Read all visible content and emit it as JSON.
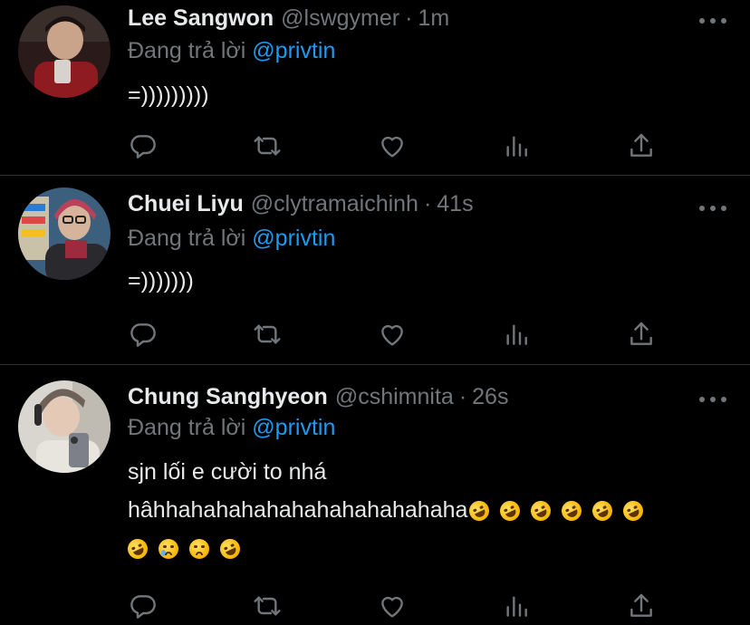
{
  "colors": {
    "background": "#000000",
    "text_primary": "#e7e9ea",
    "text_secondary": "#71767b",
    "mention": "#1d9bf0",
    "divider": "#2f3336"
  },
  "reply_prefix": "Đang trả lời",
  "tweets": [
    {
      "name": "Lee Sangwon",
      "handle": "@lswgymer",
      "separator": "·",
      "time": "1m",
      "mention": "@privtin",
      "text_lines": [
        "=)))))))))"
      ],
      "emoji_rows": []
    },
    {
      "name": "Chuei Liyu",
      "handle": "@clytramaichinh",
      "separator": "·",
      "time": "41s",
      "mention": "@privtin",
      "text_lines": [
        "=)))))))"
      ],
      "emoji_rows": []
    },
    {
      "name": "Chung Sanghyeon",
      "handle": "@cshimnita",
      "separator": "·",
      "time": "26s",
      "mention": "@privtin",
      "text_lines": [
        "sjn lối e cười to nhá",
        "hâhhahahahahahahahahahahaha"
      ],
      "emoji_rows": [
        [
          "rolling-on-floor-laughing-emoji",
          "rolling-on-floor-laughing-emoji",
          "rolling-on-floor-laughing-emoji",
          "rolling-on-floor-laughing-emoji",
          "rolling-on-floor-laughing-emoji",
          "rolling-on-floor-laughing-emoji"
        ],
        [
          "rolling-on-floor-laughing-emoji",
          "crying-face-emoji",
          "sad-face-emoji",
          "rolling-on-floor-laughing-emoji"
        ]
      ]
    }
  ],
  "action_icons": [
    "reply-icon",
    "retweet-icon",
    "like-icon",
    "stats-icon",
    "share-icon"
  ]
}
